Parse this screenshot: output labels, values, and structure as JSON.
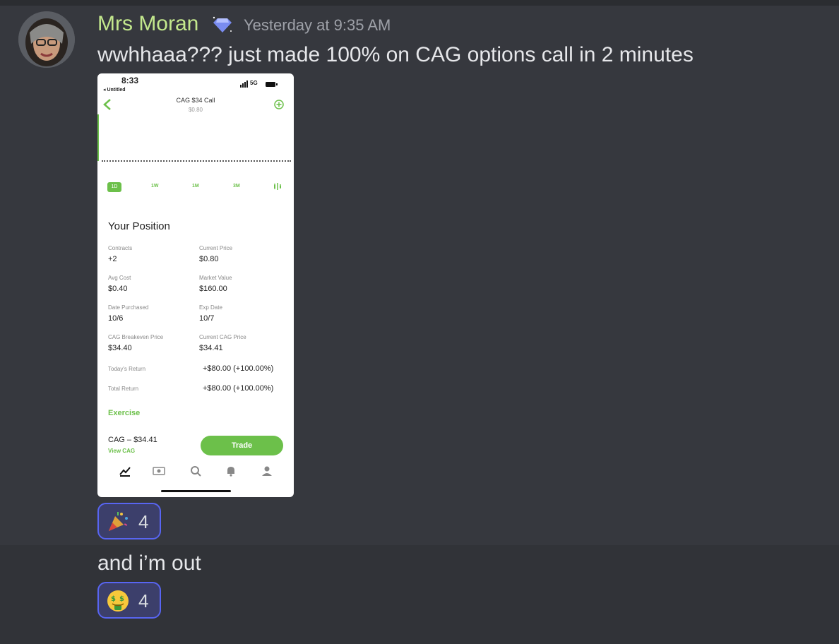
{
  "message": {
    "author": "Mrs Moran",
    "timestamp": "Yesterday at 9:35 AM",
    "text": "wwhhaaa??? just made 100% on CAG options call in 2 minutes",
    "reaction": {
      "emoji": "party-popper-icon",
      "count": "4"
    }
  },
  "followup": {
    "text": "and i’m out",
    "reaction": {
      "emoji": "money-mouth-face-icon",
      "count": "4"
    }
  },
  "phone": {
    "status_time": "8:33",
    "back_label": "◂ Untitled",
    "network": "5G",
    "title": "CAG $34 Call",
    "subtitle": "$0.80",
    "ranges": [
      "1D",
      "1W",
      "1M",
      "3M"
    ],
    "position_title": "Your Position",
    "fields": [
      {
        "label": "Contracts",
        "value": "+2"
      },
      {
        "label": "Current Price",
        "value": "$0.80"
      },
      {
        "label": "Avg Cost",
        "value": "$0.40"
      },
      {
        "label": "Market Value",
        "value": "$160.00"
      },
      {
        "label": "Date Purchased",
        "value": "10/6"
      },
      {
        "label": "Exp Date",
        "value": "10/7"
      },
      {
        "label": "CAG Breakeven Price",
        "value": "$34.40"
      },
      {
        "label": "Current CAG Price",
        "value": "$34.41"
      }
    ],
    "returns": [
      {
        "label": "Today's Return",
        "value": "+$80.00 (+100.00%)"
      },
      {
        "label": "Total Return",
        "value": "+$80.00 (+100.00%)"
      }
    ],
    "exercise": "Exercise",
    "ticker_price": "CAG – $34.41",
    "view_ticker": "View CAG",
    "trade": "Trade"
  },
  "colors": {
    "username": "#c3e88d",
    "accent_green": "#6cc04a",
    "reaction_border": "#5865f2"
  }
}
